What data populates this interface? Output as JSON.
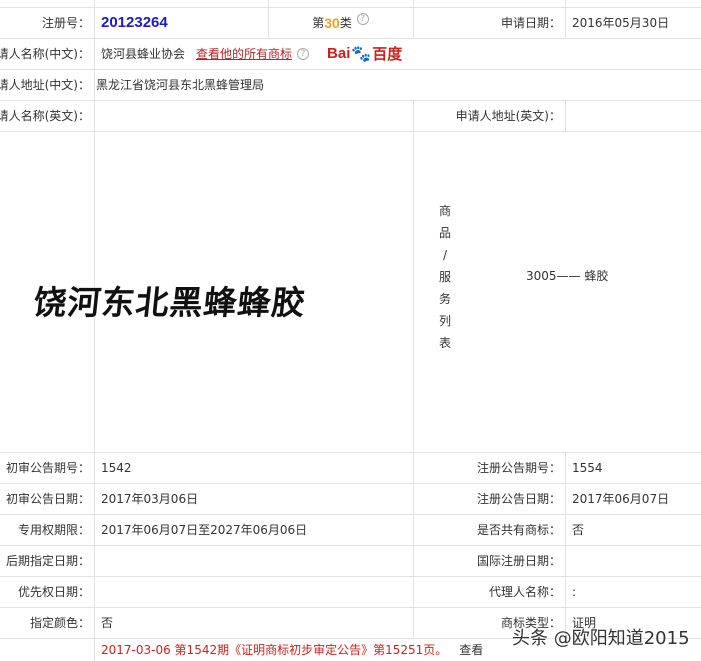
{
  "reg": {
    "label": "注册号：",
    "number": "20123264",
    "class_prefix": "第",
    "class_num": "30",
    "class_suffix": "类",
    "help": "?",
    "apply_date_label": "申请日期：",
    "apply_date": "2016年05月30日"
  },
  "applicant": {
    "name_cn_label": "请人名称(中文)：",
    "name_cn": "饶河县蜂业协会",
    "view_all_link": "查看他的所有商标",
    "help": "?",
    "baidu_text1": "Bai",
    "baidu_paw": "🐾",
    "baidu_text2": "百度",
    "addr_cn_label": "请人地址(中文)：",
    "addr_cn": "黑龙江省饶河县东北黑蜂管理局",
    "name_en_label": "请人名称(英文)：",
    "name_en": "",
    "addr_en_label": "申请人地址(英文)：",
    "addr_en": ""
  },
  "trademark": {
    "image_text": "饶河东北黑蜂蜂胶",
    "goods_label": [
      "商",
      "品",
      "/",
      "服",
      "务",
      "列",
      "表"
    ],
    "goods": "3005—— 蜂胶"
  },
  "rows": [
    {
      "l": "初审公告期号：",
      "lv": "1542",
      "r": "注册公告期号：",
      "rv": "1554"
    },
    {
      "l": "初审公告日期：",
      "lv": "2017年03月06日",
      "r": "注册公告日期：",
      "rv": "2017年06月07日"
    },
    {
      "l": "专用权期限：",
      "lv": "2017年06月07日至2027年06月06日",
      "r": "是否共有商标：",
      "rv": "否"
    },
    {
      "l": "后期指定日期：",
      "lv": "",
      "r": "国际注册日期：",
      "rv": ""
    },
    {
      "l": "优先权日期：",
      "lv": "",
      "r": "代理人名称：",
      "rv": ":"
    },
    {
      "l": "指定颜色：",
      "lv": "否",
      "r": "商标类型：",
      "rv": "证明"
    }
  ],
  "notice": {
    "text": "2017-03-06 第1542期《证明商标初步审定公告》第15251页。",
    "view": "查看"
  },
  "watermark": "头条 @欧阳知道2015"
}
